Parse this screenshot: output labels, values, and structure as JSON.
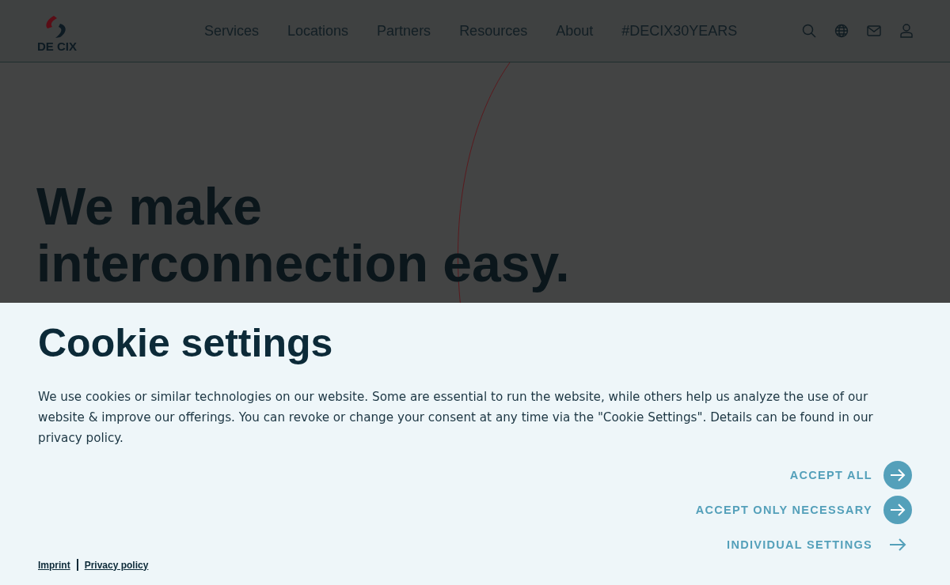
{
  "header": {
    "logo_text": "DE CIX",
    "nav": [
      {
        "label": "Services"
      },
      {
        "label": "Locations"
      },
      {
        "label": "Partners"
      },
      {
        "label": "Resources"
      },
      {
        "label": "About"
      },
      {
        "label": "#DECIX30YEARS"
      }
    ]
  },
  "hero": {
    "lines": [
      "We make",
      "interconnection easy."
    ]
  },
  "cookie_dialog": {
    "title": "Cookie settings",
    "text": "We use cookies or similar technologies on our website. Some are essential to run the website, while others help us analyze the use of our website & improve our offerings. You can revoke or change your consent at any time via the \"Cookie Settings\". Details can be found in our privacy policy.",
    "buttons": [
      {
        "label": "ACCEPT ALL",
        "kind": "filled"
      },
      {
        "label": "ACCEPT ONLY NECESSARY",
        "kind": "filled"
      },
      {
        "label": "INDIVIDUAL SETTINGS",
        "kind": "plain"
      }
    ],
    "footer_links": [
      {
        "label": "Imprint"
      },
      {
        "label": "Privacy policy"
      }
    ]
  }
}
